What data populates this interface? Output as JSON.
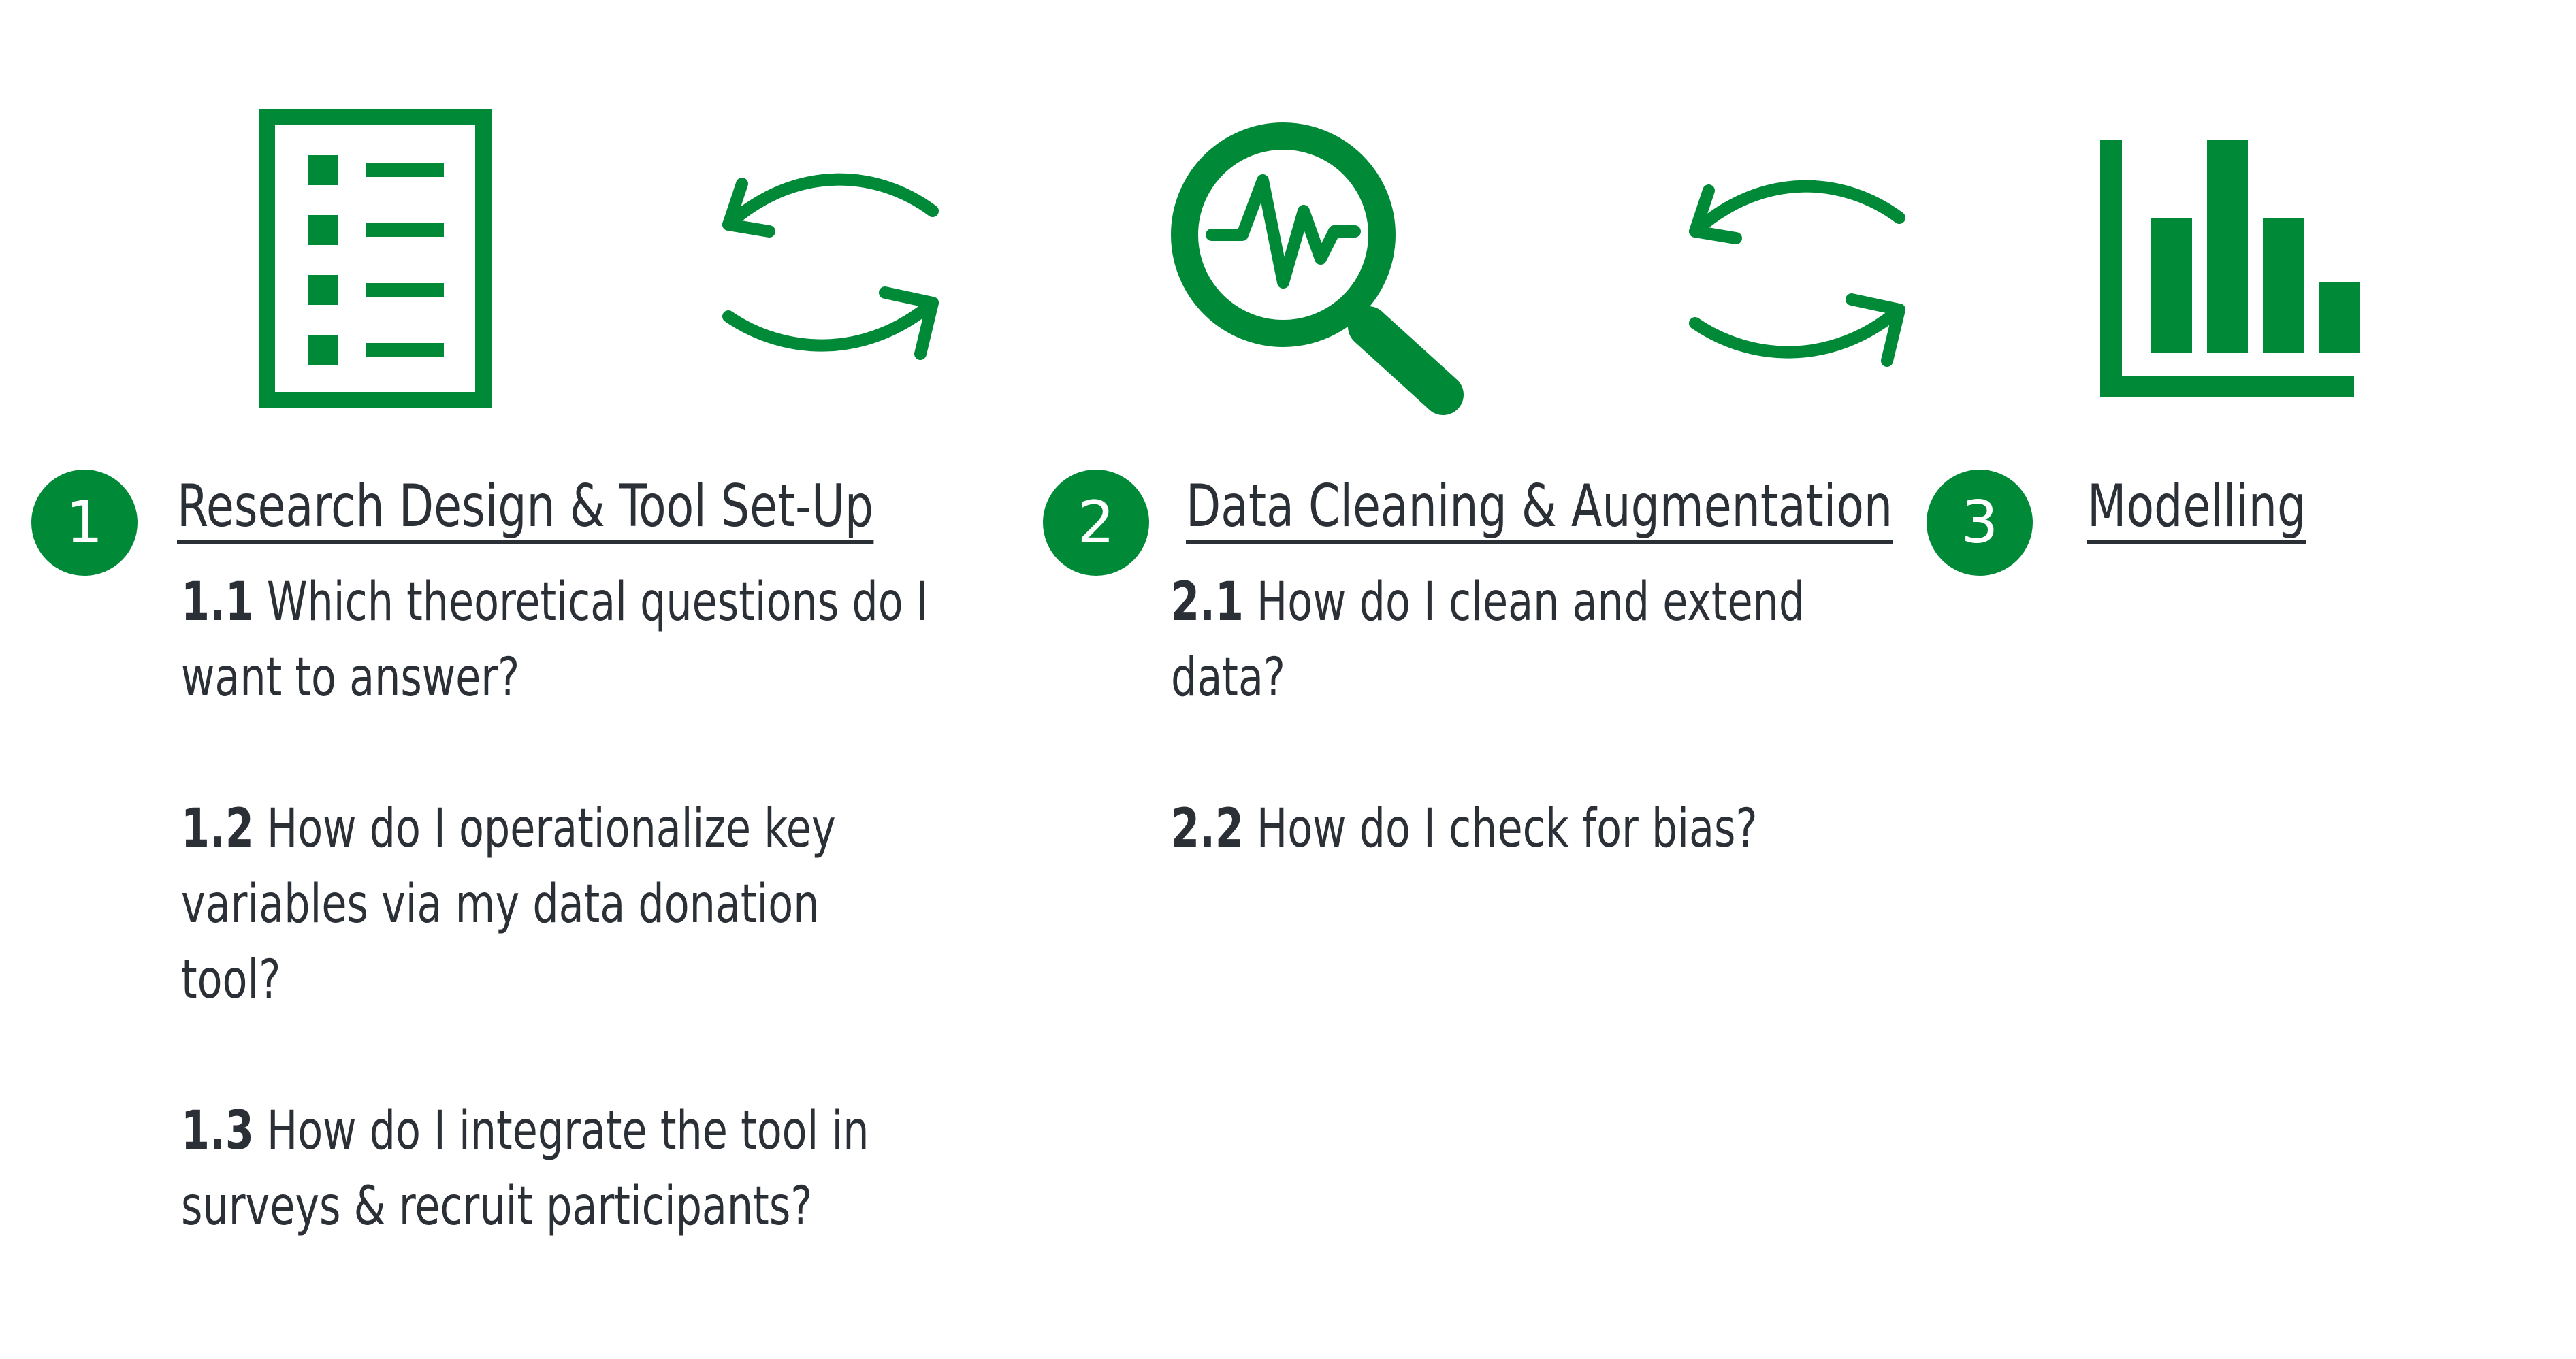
{
  "colors": {
    "accent": "#008a38",
    "text": "#2b2f36",
    "background": "#ffffff"
  },
  "steps": [
    {
      "number": "1",
      "title": "Research Design & Tool Set-Up",
      "icon": "checklist-icon",
      "questions": [
        {
          "num": "1.1",
          "text": "Which theoretical questions do I want to answer?"
        },
        {
          "num": "1.2",
          "text": "How do I operationalize key variables via my data donation tool?"
        },
        {
          "num": "1.3",
          "text": "How do I integrate the tool in surveys & recruit participants?"
        }
      ]
    },
    {
      "number": "2",
      "title": "Data Cleaning & Augmentation",
      "icon": "magnifier-pulse-icon",
      "questions": [
        {
          "num": "2.1",
          "text": "How do I clean and extend data?"
        },
        {
          "num": "2.2",
          "text": "How do I check for bias?"
        }
      ]
    },
    {
      "number": "3",
      "title": "Modelling",
      "icon": "bar-chart-icon",
      "questions": []
    }
  ],
  "connectors": [
    "cycle-arrows-icon",
    "cycle-arrows-icon"
  ]
}
